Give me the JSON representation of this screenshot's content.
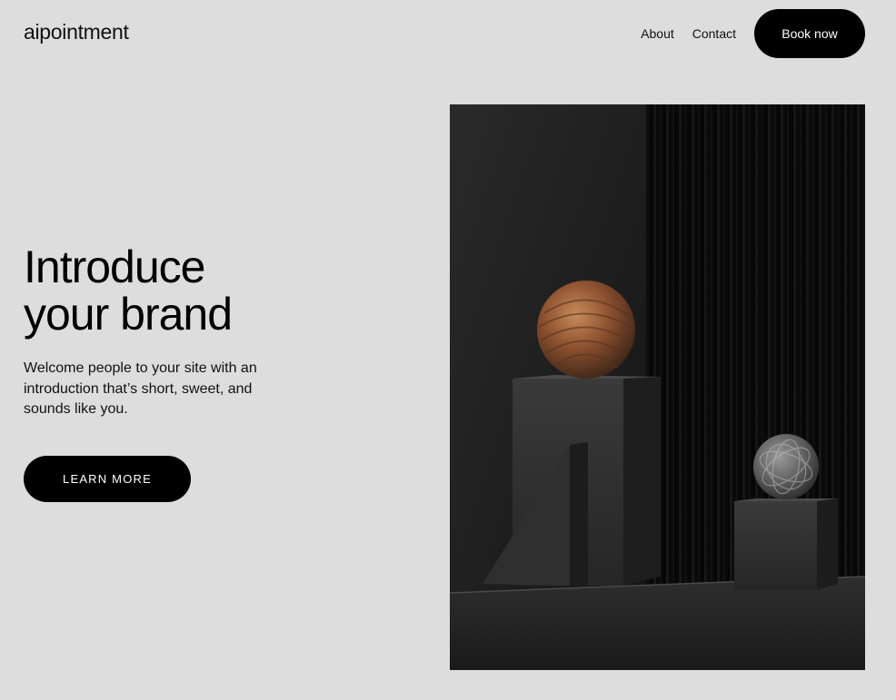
{
  "header": {
    "logo": "aipointment",
    "nav": [
      {
        "label": "About"
      },
      {
        "label": "Contact"
      }
    ],
    "book_label": "Book now"
  },
  "hero": {
    "title_line1": "Introduce",
    "title_line2": "your brand",
    "subtitle": "Welcome people to your site with an introduction that’s short, sweet, and sounds like you.",
    "cta_label": "LEARN MORE"
  },
  "colors": {
    "background": "#dddddd",
    "button": "#000000",
    "button_text": "#ffffff"
  }
}
